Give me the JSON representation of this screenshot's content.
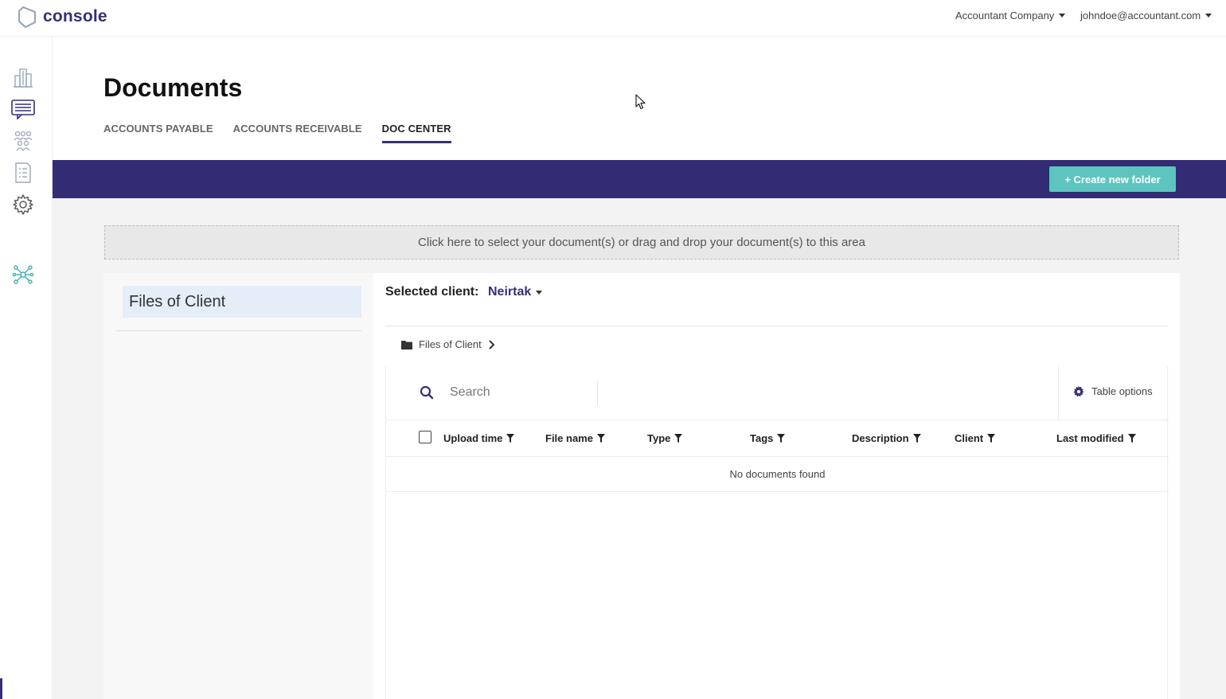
{
  "app": {
    "logo_text": "console",
    "company": "Accountant Company",
    "user": "johndoe@accountant.com"
  },
  "sidebar": {
    "items": [
      {
        "icon": "building-icon"
      },
      {
        "icon": "chat-icon"
      },
      {
        "icon": "people-icon"
      },
      {
        "icon": "document-list-icon"
      },
      {
        "icon": "gear-icon"
      },
      {
        "icon": "network-icon"
      }
    ]
  },
  "page": {
    "title": "Documents",
    "tabs": [
      {
        "label": "ACCOUNTS PAYABLE",
        "active": false
      },
      {
        "label": "ACCOUNTS RECEIVABLE",
        "active": false
      },
      {
        "label": "DOC CENTER",
        "active": true
      }
    ]
  },
  "toolbar": {
    "create_folder_label": "+ Create new folder"
  },
  "dropzone": {
    "text": "Click here to select your document(s) or drag and drop your document(s) to this area"
  },
  "folders": {
    "items": [
      {
        "label": "Files of Client",
        "selected": true
      }
    ]
  },
  "client": {
    "label": "Selected client:",
    "value": "Neirtak"
  },
  "breadcrumb": {
    "folder": "Files of Client"
  },
  "table": {
    "search_placeholder": "Search",
    "options_label": "Table options",
    "columns": [
      "Upload time",
      "File name",
      "Type",
      "Tags",
      "Description",
      "Client",
      "Last modified"
    ],
    "empty_text": "No documents found"
  },
  "colors": {
    "brand": "#34307a",
    "band": "#332b73",
    "accent": "#5dc4bf",
    "sidebar_icon": "#9aa8b8",
    "sidebar_icon_teal": "#3fb0ad"
  }
}
